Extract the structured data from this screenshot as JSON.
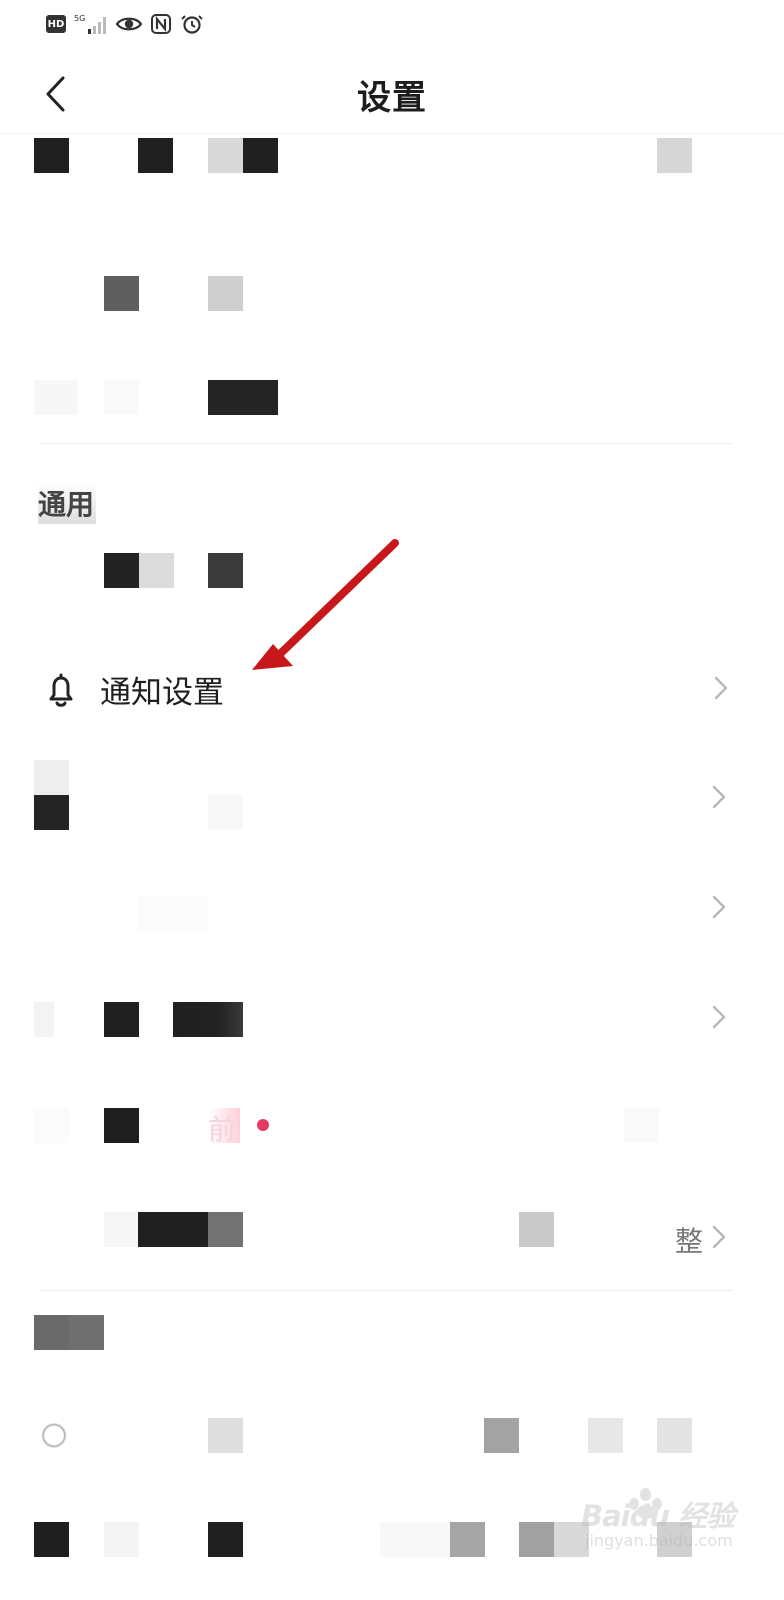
{
  "status_bar": {
    "hd_label": "HD",
    "network_label": "5G",
    "icons": [
      "signal-icon",
      "eye-icon",
      "nfc-icon",
      "alarm-icon"
    ]
  },
  "header": {
    "title": "设置",
    "back_icon": "chevron-left-icon"
  },
  "sections": {
    "general": "通用"
  },
  "notification": {
    "label": "通知设置",
    "icon": "bell-icon"
  },
  "partial": {
    "row_with_dot_fragment": "前",
    "right_text_fragment": "整"
  },
  "watermark": {
    "brand": "Baidu 经验",
    "url": "jingyan.baidu.com"
  },
  "colors": {
    "title": "#1d1d1d",
    "annotation_arrow": "#c8171b",
    "badge": "#e53b63"
  }
}
